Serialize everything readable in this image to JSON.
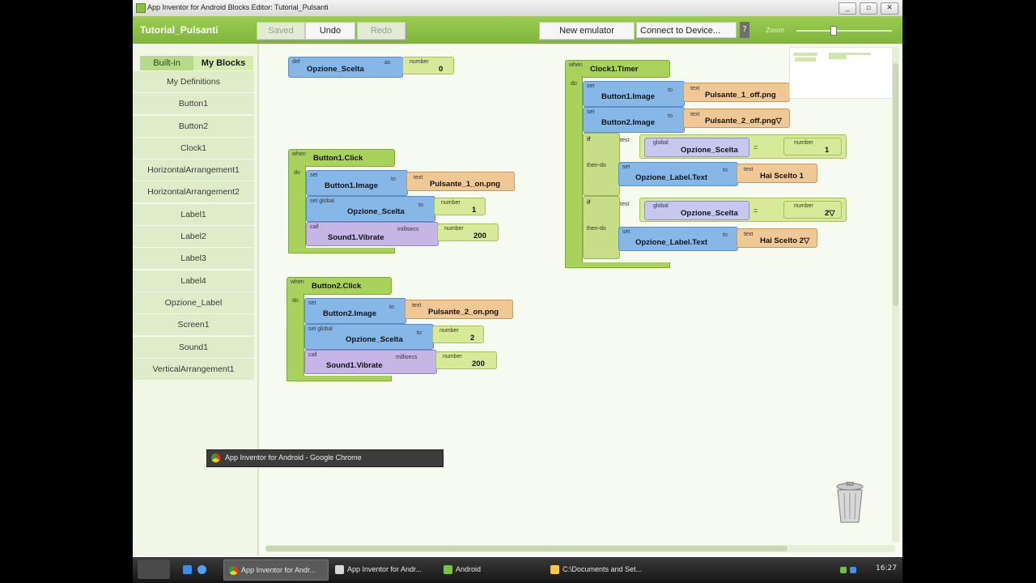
{
  "window": {
    "title": "App Inventor for Android Blocks Editor: Tutorial_Pulsanti",
    "min": "_",
    "max": "▫",
    "close": "✕"
  },
  "toolbar": {
    "project": "Tutorial_Pulsanti",
    "saved": "Saved",
    "undo": "Undo",
    "redo": "Redo",
    "new_emulator": "New emulator",
    "connect": "Connect to Device...",
    "help": "?",
    "zoom": "Zoom"
  },
  "sidebar": {
    "tabs": [
      "Built-in",
      "My Blocks"
    ],
    "items": [
      "My Definitions",
      "Button1",
      "Button2",
      "Clock1",
      "HorizontalArrangement1",
      "HorizontalArrangement2",
      "Label1",
      "Label2",
      "Label3",
      "Label4",
      "Opzione_Label",
      "Screen1",
      "Sound1",
      "VerticalArrangement1"
    ]
  },
  "blocks": {
    "def_var": {
      "def": "def",
      "name": "Opzione_Scelta",
      "as": "as",
      "number_label": "number",
      "value": "0"
    },
    "b1click": {
      "when": "when",
      "event": "Button1.Click",
      "do": "do",
      "set1": {
        "set": "set",
        "target": "Button1.Image",
        "to": "to",
        "type": "text",
        "value": "Pulsante_1_on.png"
      },
      "set2": {
        "set": "set global",
        "target": "Opzione_Scelta",
        "to": "to",
        "type": "number",
        "value": "1"
      },
      "call": {
        "call": "call",
        "target": "Sound1.Vibrate",
        "arg": "millisecs",
        "type": "number",
        "value": "200"
      }
    },
    "b2click": {
      "when": "when",
      "event": "Button2.Click",
      "do": "do",
      "set1": {
        "set": "set",
        "target": "Button2.Image",
        "to": "to",
        "type": "text",
        "value": "Pulsante_2_on.png"
      },
      "set2": {
        "set": "set global",
        "target": "Opzione_Scelta",
        "to": "to",
        "type": "number",
        "value": "2"
      },
      "call": {
        "call": "call",
        "target": "Sound1.Vibrate",
        "arg": "millisecs",
        "type": "number",
        "value": "200"
      }
    },
    "timer": {
      "when": "when",
      "event": "Clock1.Timer",
      "do": "do",
      "set1": {
        "set": "set",
        "target": "Button1.Image",
        "to": "to",
        "type": "text",
        "value": "Pulsante_1_off.png"
      },
      "set2": {
        "set": "set",
        "target": "Button2.Image",
        "to": "to",
        "type": "text",
        "value": "Pulsante_2_off.png▽"
      },
      "if1": {
        "if": "if",
        "test": "test",
        "global": "global",
        "var": "Opzione_Scelta",
        "eq": "=",
        "type": "number",
        "value": "1",
        "thendo": "then-do",
        "set": {
          "set": "set",
          "target": "Opzione_Label.Text",
          "to": "to",
          "type": "text",
          "value": "Hai Scelto 1"
        }
      },
      "if2": {
        "if": "if",
        "test": "test",
        "global": "global",
        "var": "Opzione_Scelta",
        "eq": "=",
        "type": "number",
        "value": "2▽",
        "thendo": "then-do",
        "set": {
          "set": "set",
          "target": "Opzione_Label.Text",
          "to": "to",
          "type": "text",
          "value": "Hai Scelto 2▽"
        }
      }
    }
  },
  "tooltip": "App Inventor for Android - Google Chrome",
  "taskbar": {
    "items": [
      "App Inventor for Andr...",
      "App Inventor for Andr...",
      "Android",
      "C:\\Documents and Set..."
    ],
    "clock": "16:27"
  },
  "colors": {
    "toolbar": "#8bc34a",
    "event_block": "#a9d25d",
    "set_block": "#86b7e6",
    "call_block": "#c5b6e6",
    "text_block": "#f0c896",
    "number_block": "#d6ea9a"
  }
}
